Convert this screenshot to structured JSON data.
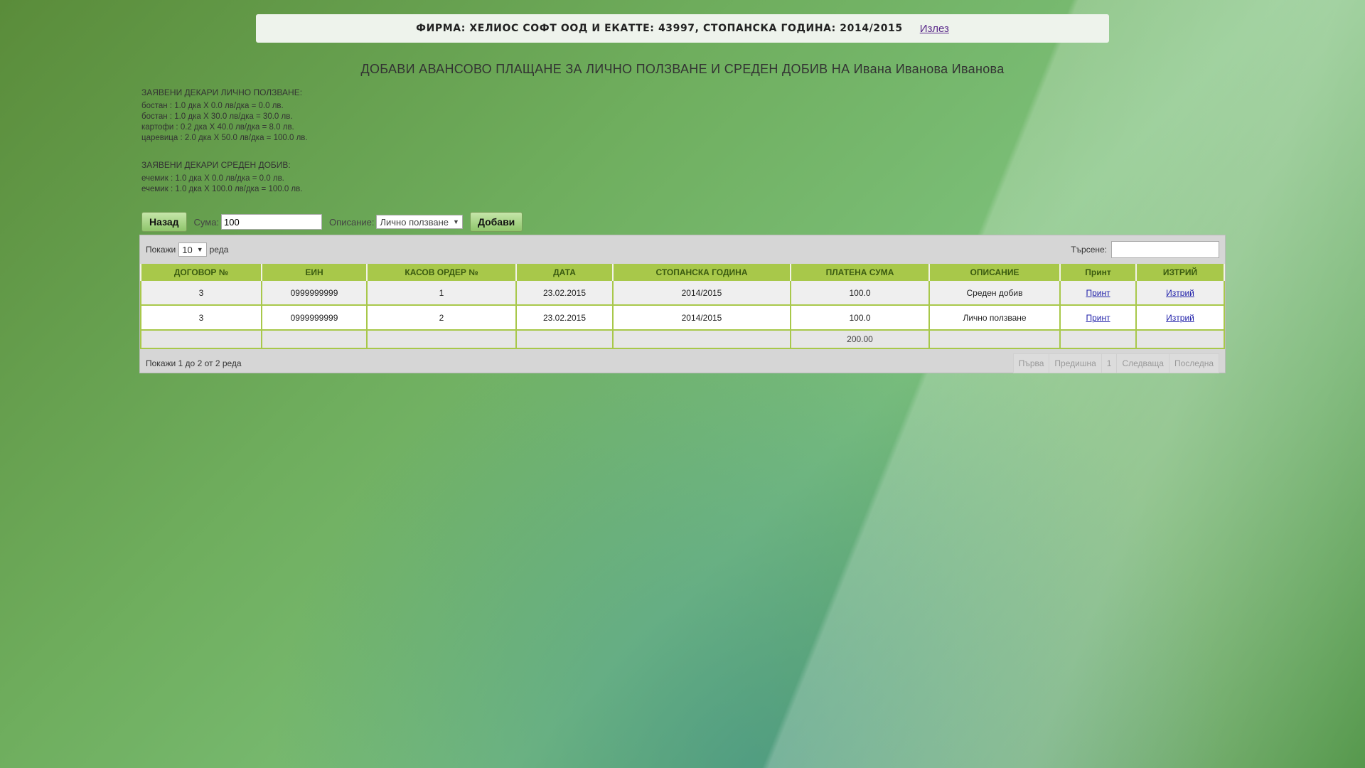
{
  "header": {
    "firm_text": "ФИРМА: ХЕЛИОС СОФТ ООД И ЕКАТТЕ: 43997, СТОПАНСКА ГОДИНА: 2014/2015",
    "logout_label": "Излез"
  },
  "page_title": "ДОБАВИ АВАНСОВО ПЛАЩАНЕ ЗА ЛИЧНО ПОЛЗВАНЕ И СРЕДЕН ДОБИВ НА Ивана Иванова Иванова",
  "personal_use": {
    "heading": "ЗАЯВЕНИ ДЕКАРИ ЛИЧНО ПОЛЗВАНЕ:",
    "lines": [
      "бостан : 1.0 дка X 0.0 лв/дка = 0.0 лв.",
      "бостан : 1.0 дка X 30.0 лв/дка = 30.0 лв.",
      "картофи : 0.2 дка X 40.0 лв/дка = 8.0 лв.",
      "царевица : 2.0 дка X 50.0 лв/дка = 100.0 лв."
    ]
  },
  "average_yield": {
    "heading": "ЗАЯВЕНИ ДЕКАРИ СРЕДЕН ДОБИВ:",
    "lines": [
      "ечемик : 1.0 дка X 0.0 лв/дка = 0.0 лв.",
      "ечемик : 1.0 дка X 100.0 лв/дка = 100.0 лв."
    ]
  },
  "controls": {
    "back_label": "Назад",
    "sum_label": "Сума:",
    "sum_value": "100",
    "description_label": "Описание:",
    "description_value": "Лично ползване",
    "add_label": "Добави"
  },
  "table_controls": {
    "show_prefix": "Покажи",
    "page_size": "10",
    "show_suffix": "реда",
    "search_label": "Търсене:",
    "search_value": ""
  },
  "table": {
    "columns": [
      "ДОГОВОР №",
      "ЕИН",
      "КАСОВ ОРДЕР №",
      "ДАТА",
      "СТОПАНСКА ГОДИНА",
      "ПЛАТЕНА СУМА",
      "ОПИСАНИЕ",
      "Принт",
      "ИЗТРИЙ"
    ],
    "rows": [
      [
        "3",
        "0999999999",
        "1",
        "23.02.2015",
        "2014/2015",
        "100.0",
        "Среден добив",
        "Принт",
        "Изтрий"
      ],
      [
        "3",
        "0999999999",
        "2",
        "23.02.2015",
        "2014/2015",
        "100.0",
        "Лично ползване",
        "Принт",
        "Изтрий"
      ]
    ],
    "total": "200.00"
  },
  "footer": {
    "info": "Покажи 1 до 2 от 2 реда",
    "first": "Първа",
    "prev": "Предишна",
    "page": "1",
    "next": "Следваща",
    "last": "Последна"
  }
}
